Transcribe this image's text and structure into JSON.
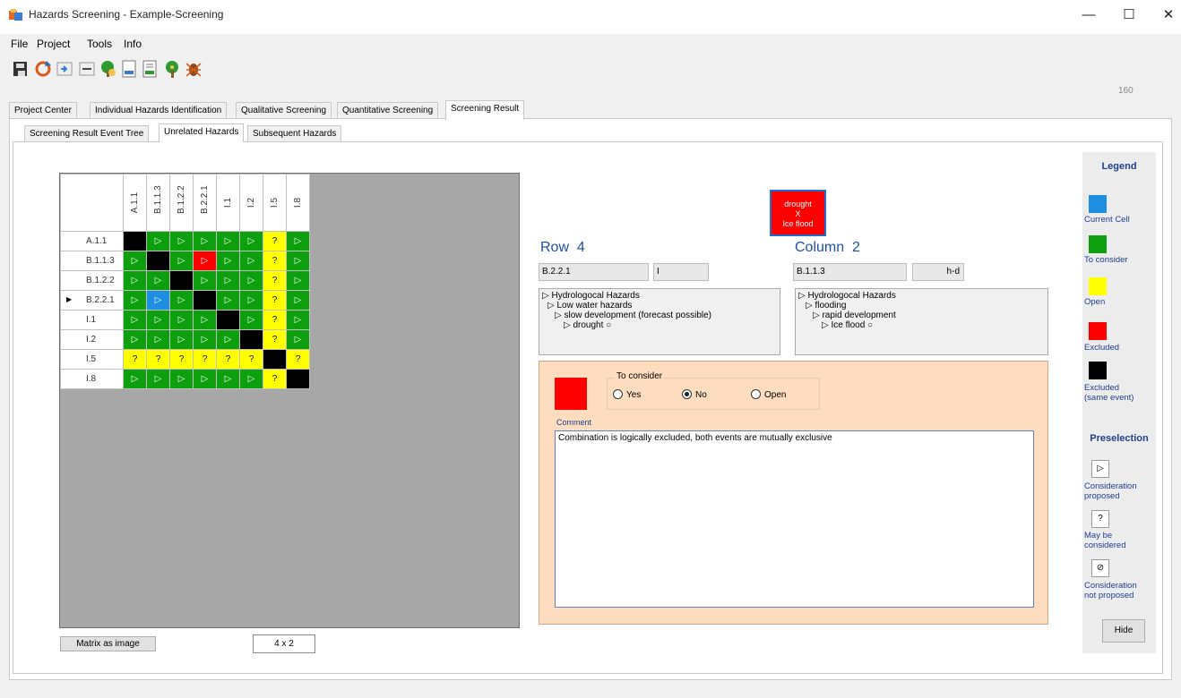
{
  "window": {
    "title": "Hazards Screening - Example-Screening",
    "minimize": "—",
    "maximize": "☐",
    "close": "✕"
  },
  "menu": [
    "File",
    "Project",
    "Tools",
    "Info"
  ],
  "toolbar_icons": [
    "save-icon",
    "refresh-icon",
    "import-icon",
    "edit-icon",
    "tree-add-icon",
    "document-icon",
    "report-icon",
    "tree-icon",
    "bug-icon"
  ],
  "counter": "160",
  "main_tabs": [
    {
      "label": "Project Center"
    },
    {
      "label": "Individual Hazards Identification"
    },
    {
      "label": "Qualitative Screening"
    },
    {
      "label": "Quantitative Screening"
    },
    {
      "label": "Screening Result"
    }
  ],
  "sub_tabs": [
    {
      "label": "Screening Result Event Tree"
    },
    {
      "label": "Unrelated Hazards"
    },
    {
      "label": "Subsequent Hazards"
    }
  ],
  "matrix": {
    "columns": [
      "A.1.1",
      "B.1.1.3",
      "B.1.2.2",
      "B.2.2.1",
      "I.1",
      "I.2",
      "I.5",
      "I.8"
    ],
    "rows": [
      {
        "label": "A.1.1",
        "cells": [
          [
            "k",
            ""
          ],
          [
            "g",
            "▷"
          ],
          [
            "g",
            "▷"
          ],
          [
            "g",
            "▷"
          ],
          [
            "g",
            "▷"
          ],
          [
            "g",
            "▷"
          ],
          [
            "y",
            "?"
          ],
          [
            "g",
            "▷"
          ]
        ]
      },
      {
        "label": "B.1.1.3",
        "cells": [
          [
            "g",
            "▷"
          ],
          [
            "k",
            ""
          ],
          [
            "g",
            "▷"
          ],
          [
            "r",
            "▷"
          ],
          [
            "g",
            "▷"
          ],
          [
            "g",
            "▷"
          ],
          [
            "y",
            "?"
          ],
          [
            "g",
            "▷"
          ]
        ]
      },
      {
        "label": "B.1.2.2",
        "cells": [
          [
            "g",
            "▷"
          ],
          [
            "g",
            "▷"
          ],
          [
            "k",
            ""
          ],
          [
            "g",
            "▷"
          ],
          [
            "g",
            "▷"
          ],
          [
            "g",
            "▷"
          ],
          [
            "y",
            "?"
          ],
          [
            "g",
            "▷"
          ]
        ]
      },
      {
        "label": "B.2.2.1",
        "cells": [
          [
            "g",
            "▷"
          ],
          [
            "b",
            "▷"
          ],
          [
            "g",
            "▷"
          ],
          [
            "k",
            ""
          ],
          [
            "g",
            "▷"
          ],
          [
            "g",
            "▷"
          ],
          [
            "y",
            "?"
          ],
          [
            "g",
            "▷"
          ]
        ]
      },
      {
        "label": "I.1",
        "cells": [
          [
            "g",
            "▷"
          ],
          [
            "g",
            "▷"
          ],
          [
            "g",
            "▷"
          ],
          [
            "g",
            "▷"
          ],
          [
            "k",
            ""
          ],
          [
            "g",
            "▷"
          ],
          [
            "y",
            "?"
          ],
          [
            "g",
            "▷"
          ]
        ]
      },
      {
        "label": "I.2",
        "cells": [
          [
            "g",
            "▷"
          ],
          [
            "g",
            "▷"
          ],
          [
            "g",
            "▷"
          ],
          [
            "g",
            "▷"
          ],
          [
            "g",
            "▷"
          ],
          [
            "k",
            ""
          ],
          [
            "y",
            "?"
          ],
          [
            "g",
            "▷"
          ]
        ]
      },
      {
        "label": "I.5",
        "cells": [
          [
            "y",
            "?"
          ],
          [
            "y",
            "?"
          ],
          [
            "y",
            "?"
          ],
          [
            "y",
            "?"
          ],
          [
            "y",
            "?"
          ],
          [
            "y",
            "?"
          ],
          [
            "k",
            ""
          ],
          [
            "y",
            "?"
          ]
        ]
      },
      {
        "label": "I.8",
        "cells": [
          [
            "g",
            "▷"
          ],
          [
            "g",
            "▷"
          ],
          [
            "g",
            "▷"
          ],
          [
            "g",
            "▷"
          ],
          [
            "g",
            "▷"
          ],
          [
            "g",
            "▷"
          ],
          [
            "y",
            "?"
          ],
          [
            "k",
            ""
          ]
        ]
      }
    ],
    "current_row_pointer": "▶"
  },
  "bottom": {
    "matrix_as_image": "Matrix as image",
    "size": "4 x 2"
  },
  "combination": {
    "line1": "drought",
    "line2": "X",
    "line3": "Ice flood"
  },
  "row_info": {
    "label": "Row",
    "number": "4",
    "id": "B.2.2.1",
    "type": "I",
    "tree": [
      "▷ Hydrologocal Hazards",
      "▷ Low water hazards",
      "▷ slow development (forecast possible)",
      "▷ drought ○"
    ]
  },
  "col_info": {
    "label": "Column",
    "number": "2",
    "id": "B.1.1.3",
    "type": "h-d",
    "tree": [
      "▷ Hydrologocal Hazards",
      "▷ flooding",
      "▷ rapid development",
      "▷ Ice flood ○"
    ]
  },
  "decision": {
    "group_label": "To consider",
    "options": [
      "Yes",
      "No",
      "Open"
    ],
    "selected": "No",
    "comment_label": "Comment",
    "comment": "Combination is logically excluded, both events are mutually exclusive"
  },
  "legend": {
    "title": "Legend",
    "items": [
      {
        "label": "Current Cell",
        "color": "#1e8fe0"
      },
      {
        "label": "To consider",
        "color": "#0e9f0e"
      },
      {
        "label": "Open",
        "color": "#ffff00"
      },
      {
        "label": "Excluded",
        "color": "#ff0000"
      },
      {
        "label": "Excluded (same event)",
        "color": "#000000"
      }
    ],
    "preselection_title": "Preselection",
    "preselection": [
      {
        "icon": "▷",
        "label": "Consideration proposed"
      },
      {
        "icon": "?",
        "label": "May be considered"
      },
      {
        "icon": "⊘",
        "label": "Consideration not proposed"
      }
    ],
    "hide": "Hide"
  }
}
